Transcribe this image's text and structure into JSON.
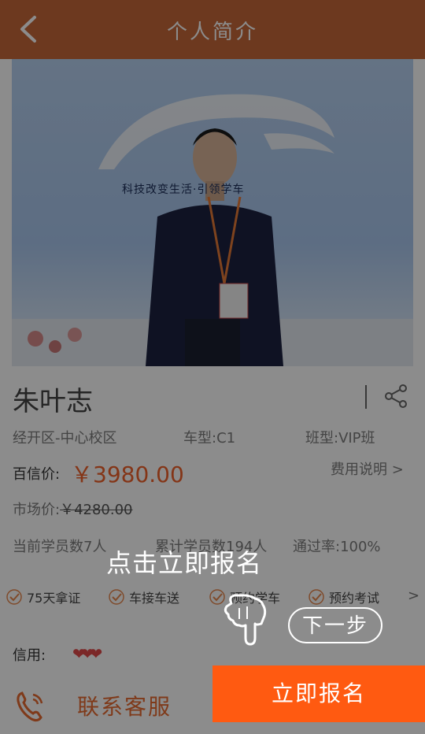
{
  "header": {
    "title": "个人简介",
    "back_icon": "chevron-left-icon"
  },
  "photo": {
    "slogan": "科技改变生活·引领学车"
  },
  "coach": {
    "name": "朱叶志",
    "campus": "经开区-中心校区",
    "car_type": "车型:C1",
    "class_type": "班型:VIP班",
    "price_label": "百信价:",
    "price_value": "￥3980.00",
    "fee_link": "费用说明 >",
    "market_label": "市场价:",
    "market_price": "￥4280.00",
    "current_students": "当前学员数7人",
    "total_students": "累计学员数194人",
    "pass_rate": "通过率:100%"
  },
  "features": [
    "75天拿证",
    "车接车送",
    "预约学车",
    "预约考试"
  ],
  "credit": {
    "label": "信用:",
    "hearts": "❤❤❤"
  },
  "bottom": {
    "contact_label": "联系客服",
    "register_label": "立即报名"
  },
  "guide": {
    "tip": "点击立即报名",
    "next_label": "下一步"
  },
  "colors": {
    "header": "#c6683a",
    "accent": "#ff5a11",
    "price": "#f0622a"
  }
}
